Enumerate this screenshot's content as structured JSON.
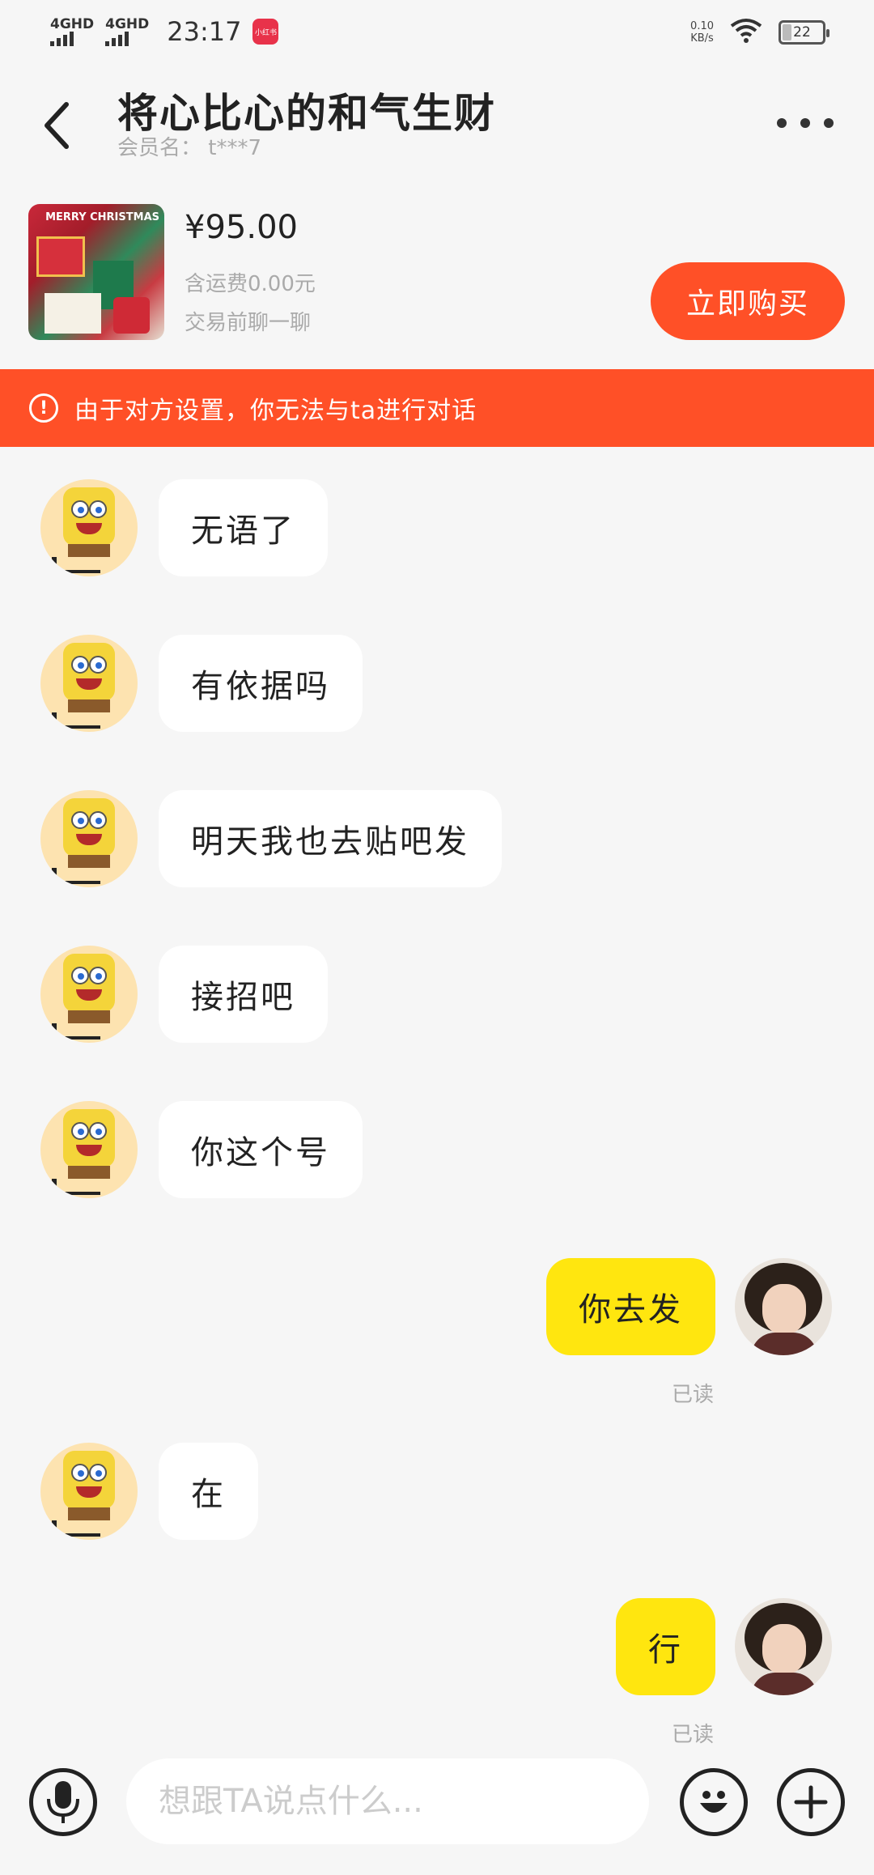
{
  "status_bar": {
    "signal_1": "4GHD",
    "signal_2": "4GHD",
    "time": "23:17",
    "app_badge": "小红书",
    "net_speed_value": "0.10",
    "net_speed_unit": "KB/s",
    "battery": "22",
    "battery_level_percent": 22
  },
  "header": {
    "title": "将心比心的和气生财",
    "member_label": "会员名： t***7"
  },
  "product": {
    "image_text": "MERRY CHRISTMAS",
    "price": "¥95.00",
    "shipping": "含运费0.00元",
    "hint": "交易前聊一聊",
    "buy_label": "立即购买"
  },
  "banner": {
    "text": "由于对方设置，你无法与ta进行对话"
  },
  "messages": [
    {
      "side": "in",
      "text": "无语了"
    },
    {
      "side": "in",
      "text": "有依据吗"
    },
    {
      "side": "in",
      "text": "明天我也去贴吧发"
    },
    {
      "side": "in",
      "text": "接招吧"
    },
    {
      "side": "in",
      "text": "你这个号"
    },
    {
      "side": "out",
      "text": "你去发",
      "status": "已读"
    },
    {
      "side": "in",
      "text": "在"
    },
    {
      "side": "out",
      "text": "行",
      "status": "已读"
    }
  ],
  "input": {
    "placeholder": "想跟TA说点什么..."
  },
  "icons": {
    "back": "chevron-left-icon",
    "more": "more-dots-icon",
    "warning": "warning-circle-icon",
    "mic": "microphone-icon",
    "emoji": "emoji-icon",
    "plus": "plus-icon"
  },
  "colors": {
    "accent": "#ff5027",
    "outgoing_bubble": "#ffe60f",
    "background": "#f6f6f6"
  }
}
